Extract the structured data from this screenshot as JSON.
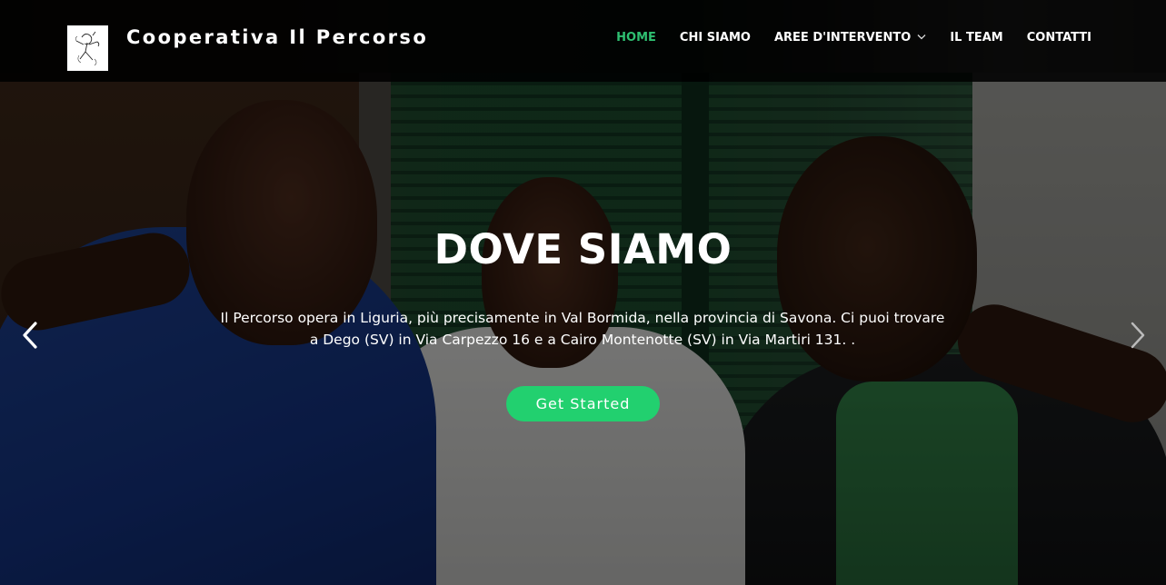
{
  "header": {
    "site_title": "Cooperativa Il Percorso",
    "logo_icon": "sketch-figure-logo",
    "nav": [
      {
        "label": "HOME",
        "active": true
      },
      {
        "label": "CHI SIAMO",
        "active": false
      },
      {
        "label": "AREE D'INTERVENTO",
        "active": false,
        "has_dropdown": true
      },
      {
        "label": "IL TEAM",
        "active": false
      },
      {
        "label": "CONTATTI",
        "active": false
      }
    ],
    "dropdown_icon": "chevron-down-icon"
  },
  "hero": {
    "title": "DOVE SIAMO",
    "text": "Il Percorso opera in Liguria, più precisamente in Val Bormida, nella provincia di Savona. Ci puoi trovare a Dego (SV) in Via Carpezzo 16 e a Cairo Montenotte (SV) in Via Martiri 131. .",
    "cta_label": "Get Started",
    "prev_icon": "chevron-left-icon",
    "next_icon": "chevron-right-icon"
  },
  "colors": {
    "accent": "#2fbf71",
    "button": "#22d06f",
    "header_bg": "#000000"
  }
}
